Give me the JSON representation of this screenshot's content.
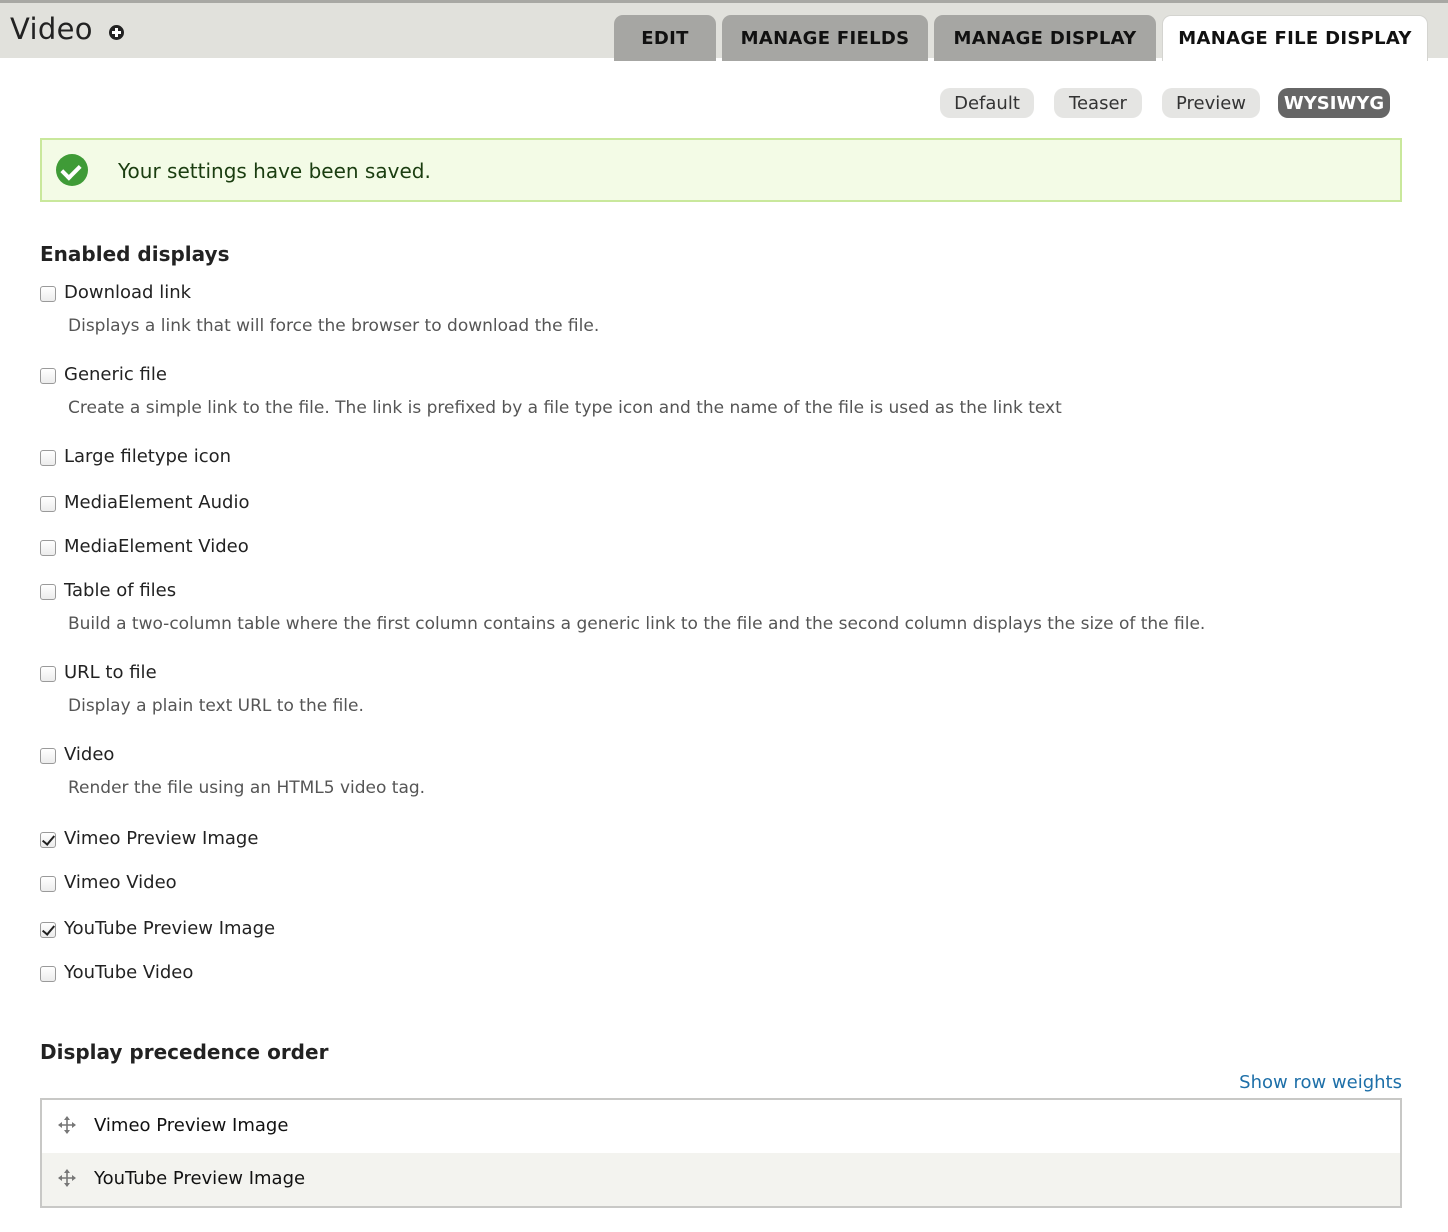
{
  "header": {
    "title": "Video",
    "tabs": [
      {
        "label": "EDIT"
      },
      {
        "label": "MANAGE FIELDS"
      },
      {
        "label": "MANAGE DISPLAY"
      },
      {
        "label": "MANAGE FILE DISPLAY",
        "active": true
      }
    ]
  },
  "view_modes": [
    {
      "label": "Default"
    },
    {
      "label": "Teaser"
    },
    {
      "label": "Preview"
    },
    {
      "label": "WYSIWYG",
      "active": true
    }
  ],
  "status": {
    "message": "Your settings have been saved.",
    "color": "#3f9b37"
  },
  "enabled_displays": {
    "title": "Enabled displays",
    "items": [
      {
        "label": "Download link",
        "checked": false,
        "description": "Displays a link that will force the browser to download the file."
      },
      {
        "label": "Generic file",
        "checked": false,
        "description": "Create a simple link to the file. The link is prefixed by a file type icon and the name of the file is used as the link text"
      },
      {
        "label": "Large filetype icon",
        "checked": false
      },
      {
        "label": "MediaElement Audio",
        "checked": false
      },
      {
        "label": "MediaElement Video",
        "checked": false
      },
      {
        "label": "Table of files",
        "checked": false,
        "description": "Build a two-column table where the first column contains a generic link to the file and the second column displays the size of the file."
      },
      {
        "label": "URL to file",
        "checked": false,
        "description": "Display a plain text URL to the file."
      },
      {
        "label": "Video",
        "checked": false,
        "description": "Render the file using an HTML5 video tag."
      },
      {
        "label": "Vimeo Preview Image",
        "checked": true
      },
      {
        "label": "Vimeo Video",
        "checked": false
      },
      {
        "label": "YouTube Preview Image",
        "checked": true
      },
      {
        "label": "YouTube Video",
        "checked": false
      }
    ]
  },
  "precedence": {
    "title": "Display precedence order",
    "weights_link": "Show row weights",
    "rows": [
      {
        "label": "Vimeo Preview Image",
        "icon": "drag-handle-icon"
      },
      {
        "label": "YouTube Preview Image",
        "icon": "drag-handle-icon"
      }
    ]
  },
  "colors": {
    "link": "#1d6fa8",
    "status_background": "#f3fbe6",
    "status_border": "#c9e89c",
    "active_pill": "#666666"
  }
}
